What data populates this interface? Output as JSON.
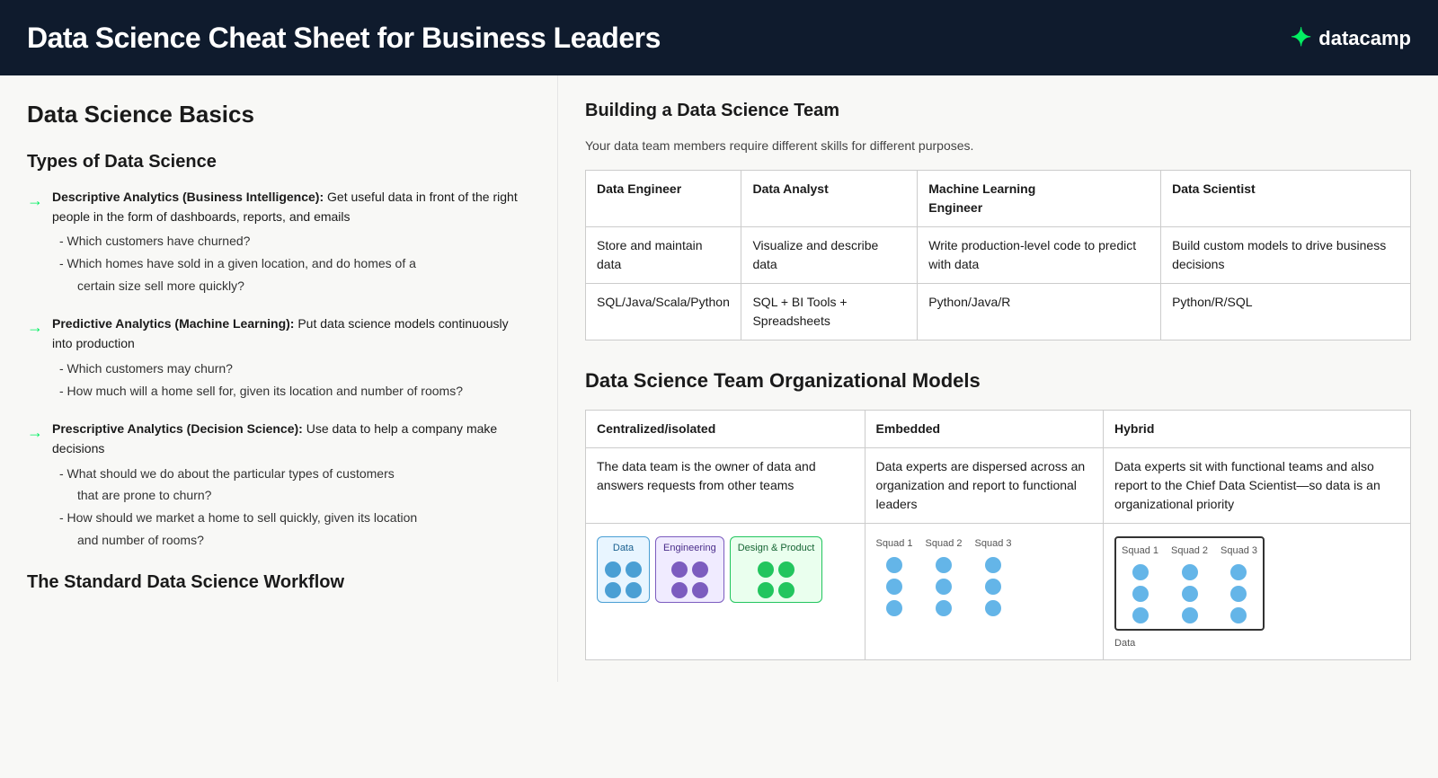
{
  "header": {
    "title": "Data Science Cheat Sheet for Business Leaders",
    "logo_text": "datacamp",
    "logo_icon": "✦"
  },
  "left": {
    "section_title": "Data Science Basics",
    "types_title": "Types of Data Science",
    "analytics": [
      {
        "label": "Descriptive Analytics (Business Intelligence):",
        "description": "Get useful data in front of the right people in the form of dashboards, reports, and emails",
        "sub_items": [
          "- Which customers have churned?",
          "- Which homes have sold in a given location, and do homes of a certain size sell more quickly?"
        ]
      },
      {
        "label": "Predictive Analytics (Machine Learning):",
        "description": "Put data science models continuously into production",
        "sub_items": [
          "- Which customers may churn?",
          "- How much will a home sell for, given its location and number of rooms?"
        ]
      },
      {
        "label": "Prescriptive Analytics (Decision Science):",
        "description": "Use data to help a company make decisions",
        "sub_items": [
          "- What should we do about the particular types of customers that are prone to churn?",
          "- How should we market a home to sell quickly, given its location and number of rooms?"
        ]
      }
    ],
    "workflow_title": "The Standard Data Science Workflow"
  },
  "right": {
    "team_title": "Building a Data Science Team",
    "team_subtitle": "Your data team members require different skills for different purposes.",
    "team_table": {
      "headers": [
        "Data Engineer",
        "Data Analyst",
        "Machine Learning Engineer",
        "Data Scientist"
      ],
      "rows": [
        [
          "Store and maintain data",
          "Visualize and describe data",
          "Write production-level code to predict with data",
          "Build custom models to drive business decisions"
        ],
        [
          "SQL/Java/Scala/Python",
          "SQL + BI Tools + Spreadsheets",
          "Python/Java/R",
          "Python/R/SQL"
        ]
      ]
    },
    "org_title": "Data Science Team Organizational Models",
    "org_table": {
      "headers": [
        "Centralized/isolated",
        "Embedded",
        "Hybrid"
      ],
      "descriptions": [
        "The data team is the owner of data and answers requests from other teams",
        "Data experts are dispersed across an organization and report to functional leaders",
        "Data experts sit with functional teams and also report to the Chief Data Scientist—so data is an organizational priority"
      ]
    },
    "org_diagram": {
      "centralized": {
        "boxes": [
          "Data",
          "Engineering",
          "Design & Product"
        ],
        "colors": [
          "data",
          "eng",
          "design"
        ]
      },
      "embedded": {
        "squads": [
          "Squad 1",
          "Squad 2",
          "Squad 3"
        ]
      },
      "hybrid": {
        "squads": [
          "Squad 1",
          "Squad 2",
          "Squad 3"
        ],
        "bottom_label": "Data"
      }
    }
  }
}
